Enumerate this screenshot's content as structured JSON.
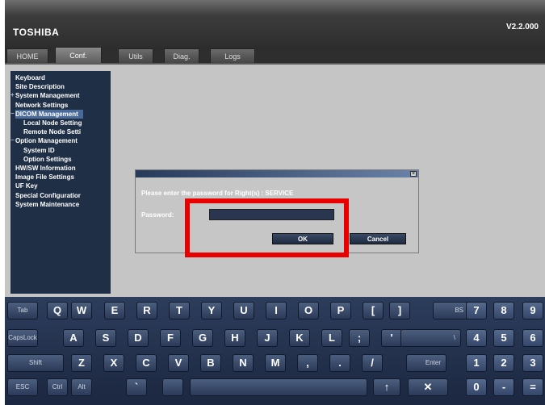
{
  "header": {
    "brand": "TOSHIBA",
    "version": "V2.2.000"
  },
  "tabs": [
    "HOME",
    "Conf.",
    "Utils",
    "Diag.",
    "Logs"
  ],
  "active_tab": "Conf.",
  "tree": [
    {
      "label": "Keyboard",
      "level": 0,
      "twist": ""
    },
    {
      "label": "Site Description",
      "level": 0,
      "twist": ""
    },
    {
      "label": "System Management",
      "level": 0,
      "twist": "+"
    },
    {
      "label": "Network Settings",
      "level": 0,
      "twist": ""
    },
    {
      "label": "DICOM Management",
      "level": 0,
      "twist": "−",
      "selected": true
    },
    {
      "label": "Local Node Setting",
      "level": 1,
      "twist": ""
    },
    {
      "label": "Remote Node Setti",
      "level": 1,
      "twist": ""
    },
    {
      "label": "Option Management",
      "level": 0,
      "twist": "−"
    },
    {
      "label": "System ID",
      "level": 1,
      "twist": ""
    },
    {
      "label": "Option Settings",
      "level": 1,
      "twist": ""
    },
    {
      "label": "HW/SW Information",
      "level": 0,
      "twist": ""
    },
    {
      "label": "Image File Settings",
      "level": 0,
      "twist": ""
    },
    {
      "label": "UF Key",
      "level": 0,
      "twist": ""
    },
    {
      "label": "Special Configuratior",
      "level": 0,
      "twist": ""
    },
    {
      "label": "System Maintenance",
      "level": 0,
      "twist": ""
    }
  ],
  "dialog": {
    "close": "×",
    "prompt": "Please enter the password for Right(s) :  SERVICE",
    "password_label": "Password:",
    "password_value": "",
    "ok": "OK",
    "cancel": "Cancel"
  },
  "keyboard": {
    "rows": [
      [
        "Tab",
        "Q",
        "W",
        "E",
        "R",
        "T",
        "Y",
        "U",
        "I",
        "O",
        "P",
        "[",
        "]",
        "BS",
        "7",
        "8",
        "9"
      ],
      [
        "CapsLock",
        "A",
        "S",
        "D",
        "F",
        "G",
        "H",
        "J",
        "K",
        "L",
        ";",
        "'",
        "\\",
        "4",
        "5",
        "6"
      ],
      [
        "Shift",
        "Z",
        "X",
        "C",
        "V",
        "B",
        "N",
        "M",
        ",",
        ".",
        "/",
        "Enter",
        "1",
        "2",
        "3"
      ],
      [
        "ESC",
        "Ctrl",
        "Alt",
        "`",
        "",
        "",
        "↑",
        "✕",
        "0",
        "-",
        "="
      ]
    ]
  }
}
